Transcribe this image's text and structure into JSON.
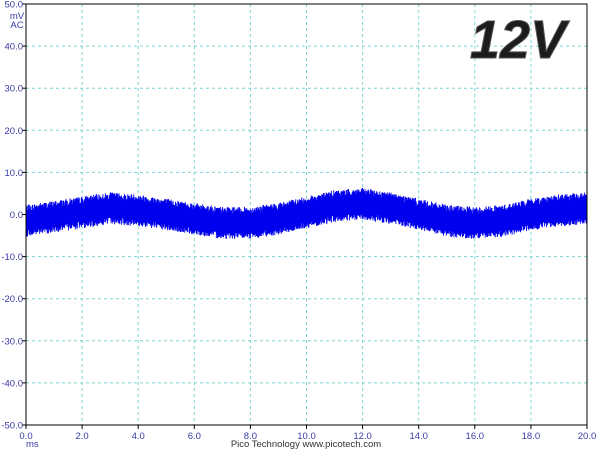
{
  "badge": "12V",
  "credit": "Pico Technology  www.picotech.com",
  "y_unit": [
    "mV",
    "AC"
  ],
  "x_unit": "ms",
  "colors": {
    "trace": "#0000ee",
    "grid": "#7fd4d4",
    "axis": "#000000"
  },
  "chart_data": {
    "type": "line",
    "title": "",
    "xlabel": "ms",
    "ylabel": "mV AC",
    "xlim": [
      0.0,
      20.0
    ],
    "ylim": [
      -50.0,
      50.0
    ],
    "grid": true,
    "x_ticks": [
      "0.0",
      "2.0",
      "4.0",
      "6.0",
      "8.0",
      "10.0",
      "12.0",
      "14.0",
      "16.0",
      "18.0",
      "20.0"
    ],
    "y_ticks": [
      "50.0",
      "40.0",
      "30.0",
      "20.0",
      "10.0",
      "0.0",
      "-10.0",
      "-20.0",
      "-30.0",
      "-40.0",
      "-50.0"
    ],
    "series": [
      {
        "x": [
          0.0,
          1.0,
          2.0,
          3.0,
          4.0,
          5.0,
          6.0,
          7.0,
          8.0,
          9.0,
          10.0,
          11.0,
          12.0,
          13.0,
          14.0,
          15.0,
          16.0,
          17.0,
          18.0,
          19.0,
          20.0
        ],
        "y": [
          -1.5,
          -0.5,
          0.5,
          1.5,
          1.0,
          0.0,
          -1.0,
          -2.0,
          -2.0,
          -1.0,
          0.5,
          2.0,
          2.5,
          1.5,
          0.0,
          -1.5,
          -2.0,
          -1.5,
          0.0,
          1.0,
          1.5
        ],
        "noise_mv": 3.8
      }
    ]
  }
}
